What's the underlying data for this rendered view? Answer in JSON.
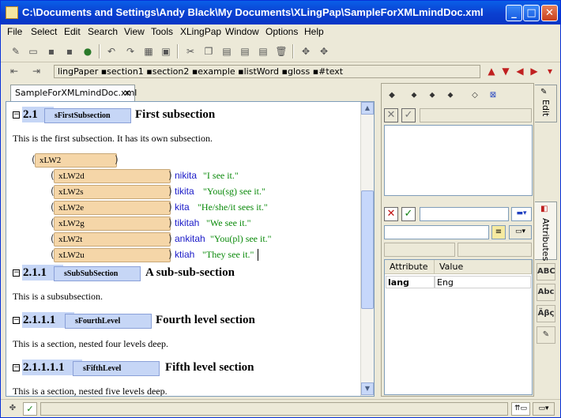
{
  "window": {
    "title": "C:\\Documents and Settings\\Andy Black\\My Documents\\XLingPap\\SampleForXMLmindDoc.xml",
    "minimize": "_",
    "maximize": "□",
    "close": "✕"
  },
  "menu": [
    "File",
    "Select",
    "Edit",
    "Search",
    "View",
    "Tools",
    "XLingPap",
    "Window",
    "Options",
    "Help"
  ],
  "path": "lingPaper ▪section1 ▪section2 ▪example ▪listWord ▪gloss ▪#text",
  "tab": {
    "label": "SampleForXMLmindDoc.xml",
    "close": "✕"
  },
  "doc": {
    "s1": {
      "num": "2.1",
      "id": "sFirstSubsection",
      "title": "First subsection",
      "para": "This is the first subsection. It has its own subsection."
    },
    "lw_main": "xLW2",
    "rows": [
      {
        "id": "xLW2d",
        "vern": "nikita",
        "gloss": "\"I see it.\""
      },
      {
        "id": "xLW2s",
        "vern": "tikita",
        "gloss": "\"You(sg) see it.\""
      },
      {
        "id": "xLW2e",
        "vern": "kita",
        "gloss": "\"He/she/it sees it.\""
      },
      {
        "id": "xLW2g",
        "vern": "tikitah",
        "gloss": "\"We see it.\""
      },
      {
        "id": "xLW2t",
        "vern": "ankitah",
        "gloss": "\"You(pl) see it.\""
      },
      {
        "id": "xLW2u",
        "vern": "ktiah",
        "gloss": "\"They see it.\""
      }
    ],
    "s2": {
      "num": "2.1.1",
      "id": "sSubSubSection",
      "title": "A sub-sub-section",
      "para": "This is a subsubsection."
    },
    "s3": {
      "num": "2.1.1.1",
      "id": "sFourthLevel",
      "title": "Fourth level section",
      "para": "This is a section, nested four levels deep."
    },
    "s4": {
      "num": "2.1.1.1.1",
      "id": "sFifthLevel",
      "title": "Fifth level section",
      "para": "This is a section, nested five levels deep."
    }
  },
  "attributes": {
    "headers": [
      "Attribute",
      "Value"
    ],
    "rows": [
      {
        "name": "lang",
        "value": "Eng"
      }
    ]
  },
  "side_tabs": {
    "edit": "Edit",
    "attributes": "Attributes"
  },
  "icons": {
    "side": [
      "ABC",
      "Abc",
      "Äβς"
    ]
  }
}
